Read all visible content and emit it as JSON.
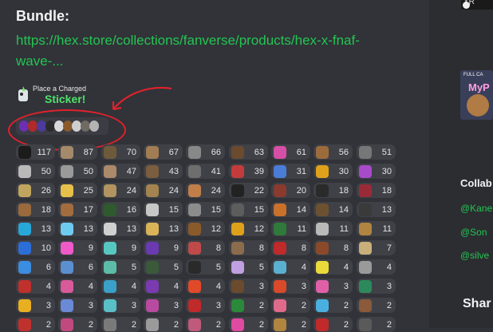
{
  "message": {
    "title": "Bundle:",
    "link_line1": "https://hex.store/collections/fanverse/products/hex-x-fnaf-",
    "link_line2": "wave-..."
  },
  "sticker": {
    "small": "Place a Charged",
    "big": "Sticker!"
  },
  "annotation_color": "#e0212d",
  "mini_stickers": [
    "#6b2fb3",
    "#b02a2a",
    "#4a3b9c",
    "#2b2b2b",
    "#d9d9d9",
    "#8a5a2b",
    "#cfcfcf",
    "#6f6a63",
    "#b4b4b4"
  ],
  "counts": [
    [
      "117",
      "87",
      "70",
      "67",
      "66",
      "63",
      "61",
      "56",
      "51"
    ],
    [
      "50",
      "50",
      "47",
      "43",
      "41",
      "39",
      "31",
      "30",
      "30"
    ],
    [
      "26",
      "25",
      "24",
      "24",
      "24",
      "22",
      "20",
      "18",
      "18"
    ],
    [
      "18",
      "17",
      "16",
      "15",
      "15",
      "15",
      "14",
      "14",
      "13"
    ],
    [
      "13",
      "13",
      "13",
      "13",
      "12",
      "12",
      "11",
      "11",
      "11"
    ],
    [
      "10",
      "9",
      "9",
      "9",
      "8",
      "8",
      "8",
      "8",
      "7"
    ],
    [
      "6",
      "6",
      "5",
      "5",
      "5",
      "5",
      "4",
      "4",
      "4"
    ],
    [
      "4",
      "4",
      "4",
      "4",
      "4",
      "3",
      "3",
      "3",
      "3"
    ],
    [
      "3",
      "3",
      "3",
      "3",
      "3",
      "2",
      "2",
      "2",
      "2"
    ],
    [
      "2",
      "2",
      "2",
      "2",
      "2",
      "2",
      "2",
      "2",
      "2"
    ]
  ],
  "icon_colors": [
    [
      "#1c1c1c",
      "#a48a6a",
      "#6e5a3a",
      "#a27c52",
      "#888888",
      "#6b4a2e",
      "#d64fa6",
      "#9c6b3c",
      "#777777"
    ],
    [
      "#b9b9b9",
      "#9a9a9a",
      "#aa8a6b",
      "#7b5d3f",
      "#6e6e6e",
      "#c43b3b",
      "#4a7dd8",
      "#e0a11a",
      "#a74bc9"
    ],
    [
      "#c0a55e",
      "#e6c04a",
      "#b1945f",
      "#a3834f",
      "#c07f48",
      "#222222",
      "#8a3a2e",
      "#2a2a2a",
      "#9b2a38"
    ],
    [
      "#9a6a3c",
      "#a36c3e",
      "#2e5a2e",
      "#c7c7c7",
      "#8c8c8c",
      "#5d5d5d",
      "#c9702a",
      "#6c5130",
      "#3a3a3a"
    ],
    [
      "#28a8d8",
      "#6ecbf0",
      "#d0d0d0",
      "#d8b357",
      "#8a5a2b",
      "#e0a11a",
      "#2f7a3a",
      "#b9b9b9",
      "#b0853f"
    ],
    [
      "#2c6ed8",
      "#f05ac8",
      "#57c8c0",
      "#6a3ab0",
      "#c04a4a",
      "#8c6c4c",
      "#bf2a2a",
      "#8a4a2a",
      "#c9b07a"
    ],
    [
      "#3a8de0",
      "#5a8fd0",
      "#5cbca8",
      "#3a5a3a",
      "#2a2a2a",
      "#c0a0e0",
      "#5ab0d0",
      "#eadb3a",
      "#9a9a9a"
    ],
    [
      "#c0302c",
      "#d85a9a",
      "#3aa0c8",
      "#7a3ab0",
      "#e04a2a",
      "#6b4a2e",
      "#d84a2a",
      "#e060a8",
      "#2c8a5a"
    ],
    [
      "#e8b020",
      "#6a8ad8",
      "#5ac0c8",
      "#b84aa0",
      "#c02a2a",
      "#2a8a3a",
      "#e06a8a",
      "#4ab0e0",
      "#8a5a3a"
    ],
    [
      "#c0302c",
      "#c04a80",
      "#7a7a7a",
      "#9a9a9a",
      "#c05a7a",
      "#e04aa0",
      "#b0853f",
      "#c02a2a",
      "#5a5a5a"
    ]
  ],
  "sidebar": {
    "top_tag": "XR",
    "thumb_line1": "FULL CA",
    "thumb_line2": "MyP",
    "heading": "Collab",
    "links": [
      "@Kane",
      "@Son",
      "@silve"
    ],
    "footer": "Shar"
  }
}
